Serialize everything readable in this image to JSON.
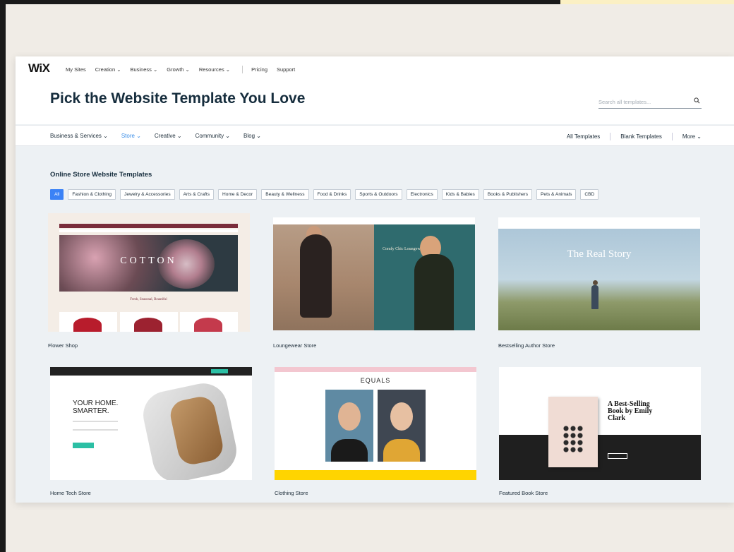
{
  "brand": {
    "logo": "WiX"
  },
  "topnav": {
    "items": [
      "My Sites",
      "Creation ⌄",
      "Business ⌄",
      "Growth ⌄",
      "Resources ⌄"
    ],
    "secondary": [
      "Pricing",
      "Support"
    ]
  },
  "page": {
    "title": "Pick the Website Template You Love"
  },
  "search": {
    "placeholder": "Search all templates..."
  },
  "categories": {
    "items": [
      "Business & Services ⌄",
      "Store ⌄",
      "Creative ⌄",
      "Community ⌄",
      "Blog ⌄"
    ],
    "active": "Store ⌄",
    "right": [
      "All Templates",
      "Blank Templates",
      "More ⌄"
    ]
  },
  "section": {
    "title": "Online Store Website Templates"
  },
  "filters": {
    "chips": [
      "All",
      "Fashion & Clothing",
      "Jewelry & Accessories",
      "Arts & Crafts",
      "Home & Decor",
      "Beauty & Wellness",
      "Food & Drinks",
      "Sports & Outdoors",
      "Electronics",
      "Kids & Babies",
      "Books & Publishers",
      "Pets & Animals",
      "CBD"
    ],
    "active": "All"
  },
  "templates": [
    {
      "label": "Flower Shop",
      "hero_text": "COTTON",
      "sub_text": "Fresh, Seasonal, Beautiful"
    },
    {
      "label": "Loungewear Store",
      "hero_text": "Comfy Chic Loungewear"
    },
    {
      "label": "Bestselling Author Store",
      "hero_text": "The Real Story"
    },
    {
      "label": "Home Tech Store",
      "hero_text": "YOUR HOME. SMARTER."
    },
    {
      "label": "Clothing Store",
      "hero_text": "EQUALS"
    },
    {
      "label": "Featured Book Store",
      "hero_text": "A Best-Selling Book by Emily Clark"
    }
  ],
  "colors": {
    "accent": "#3b82f6",
    "page_bg": "#f0ece6",
    "panel_bg": "#edf1f4"
  }
}
